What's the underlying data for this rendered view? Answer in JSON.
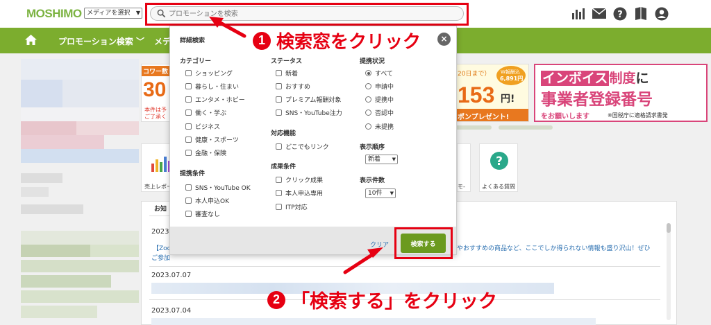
{
  "header": {
    "logo": "MOSHIMO",
    "media_select": "メディアを選択",
    "search_placeholder": "プロモーションを検索",
    "icons": [
      "bar-chart-icon",
      "mail-icon",
      "help-icon",
      "bookmark-icon",
      "user-icon"
    ]
  },
  "nav": {
    "promo": "プロモーション検索 ﹀",
    "media": "メデ"
  },
  "notice": {
    "tab": "お知",
    "dates": [
      "2023",
      "2023.07.07",
      "2023.07.04"
    ],
    "link_start": "【Zoo",
    "link_line2": "ご参加",
    "link_right": "やおすすめの商品など、ここでしか得られない情報も盛り沢山！ぜひ"
  },
  "tiles": {
    "sales_report": "売上レポー",
    "faq": "よくある質問",
    "partial": "モ-"
  },
  "banners": {
    "left_line1": "コワー数",
    "left_big": "30",
    "left_small1": "本件は予",
    "left_small2": "ご了承く",
    "mid_top": "20日まで）",
    "mid_badge1": "W報酬込",
    "mid_badge2": "6,891円",
    "mid_big": "153",
    "mid_yen": "円!",
    "mid_bottom": "ポンプレゼント!",
    "right_line1a": "インボイス",
    "right_line1b": "制度",
    "right_line1c": "に",
    "right_line2": "事業者登録番号",
    "right_line3": "をお願いします",
    "right_line3b": "※国税庁に適格請求書発"
  },
  "modal": {
    "title": "詳細検索",
    "category": {
      "heading": "カテゴリー",
      "items": [
        "ショッピング",
        "暮らし・住まい",
        "エンタメ・ホビー",
        "働く・学ぶ",
        "ビジネス",
        "健康・スポーツ",
        "金融・保険"
      ]
    },
    "conditions": {
      "heading": "提携条件",
      "items": [
        "SNS・YouTube OK",
        "本人申込OK",
        "審査なし"
      ]
    },
    "status": {
      "heading": "ステータス",
      "items": [
        "新着",
        "おすすめ",
        "プレミアム報酬対象",
        "SNS・YouTube注力"
      ]
    },
    "features": {
      "heading": "対応機能",
      "items": [
        "どこでもリンク"
      ]
    },
    "result": {
      "heading": "成果条件",
      "items": [
        "クリック成果",
        "本人申込専用",
        "ITP対応"
      ]
    },
    "partnership": {
      "heading": "提携状況",
      "items": [
        "すべて",
        "申請中",
        "提携中",
        "否認中",
        "未提携"
      ],
      "selected": "すべて"
    },
    "order": {
      "heading": "表示順序",
      "value": "新着"
    },
    "count": {
      "heading": "表示件数",
      "value": "10件"
    },
    "clear": "クリア",
    "submit": "検索する"
  },
  "annotations": {
    "step1_num": "1",
    "step1": "検索窓をクリック",
    "step2_num": "2",
    "step2": "「検索する」をクリック",
    "color": "#e60012"
  }
}
